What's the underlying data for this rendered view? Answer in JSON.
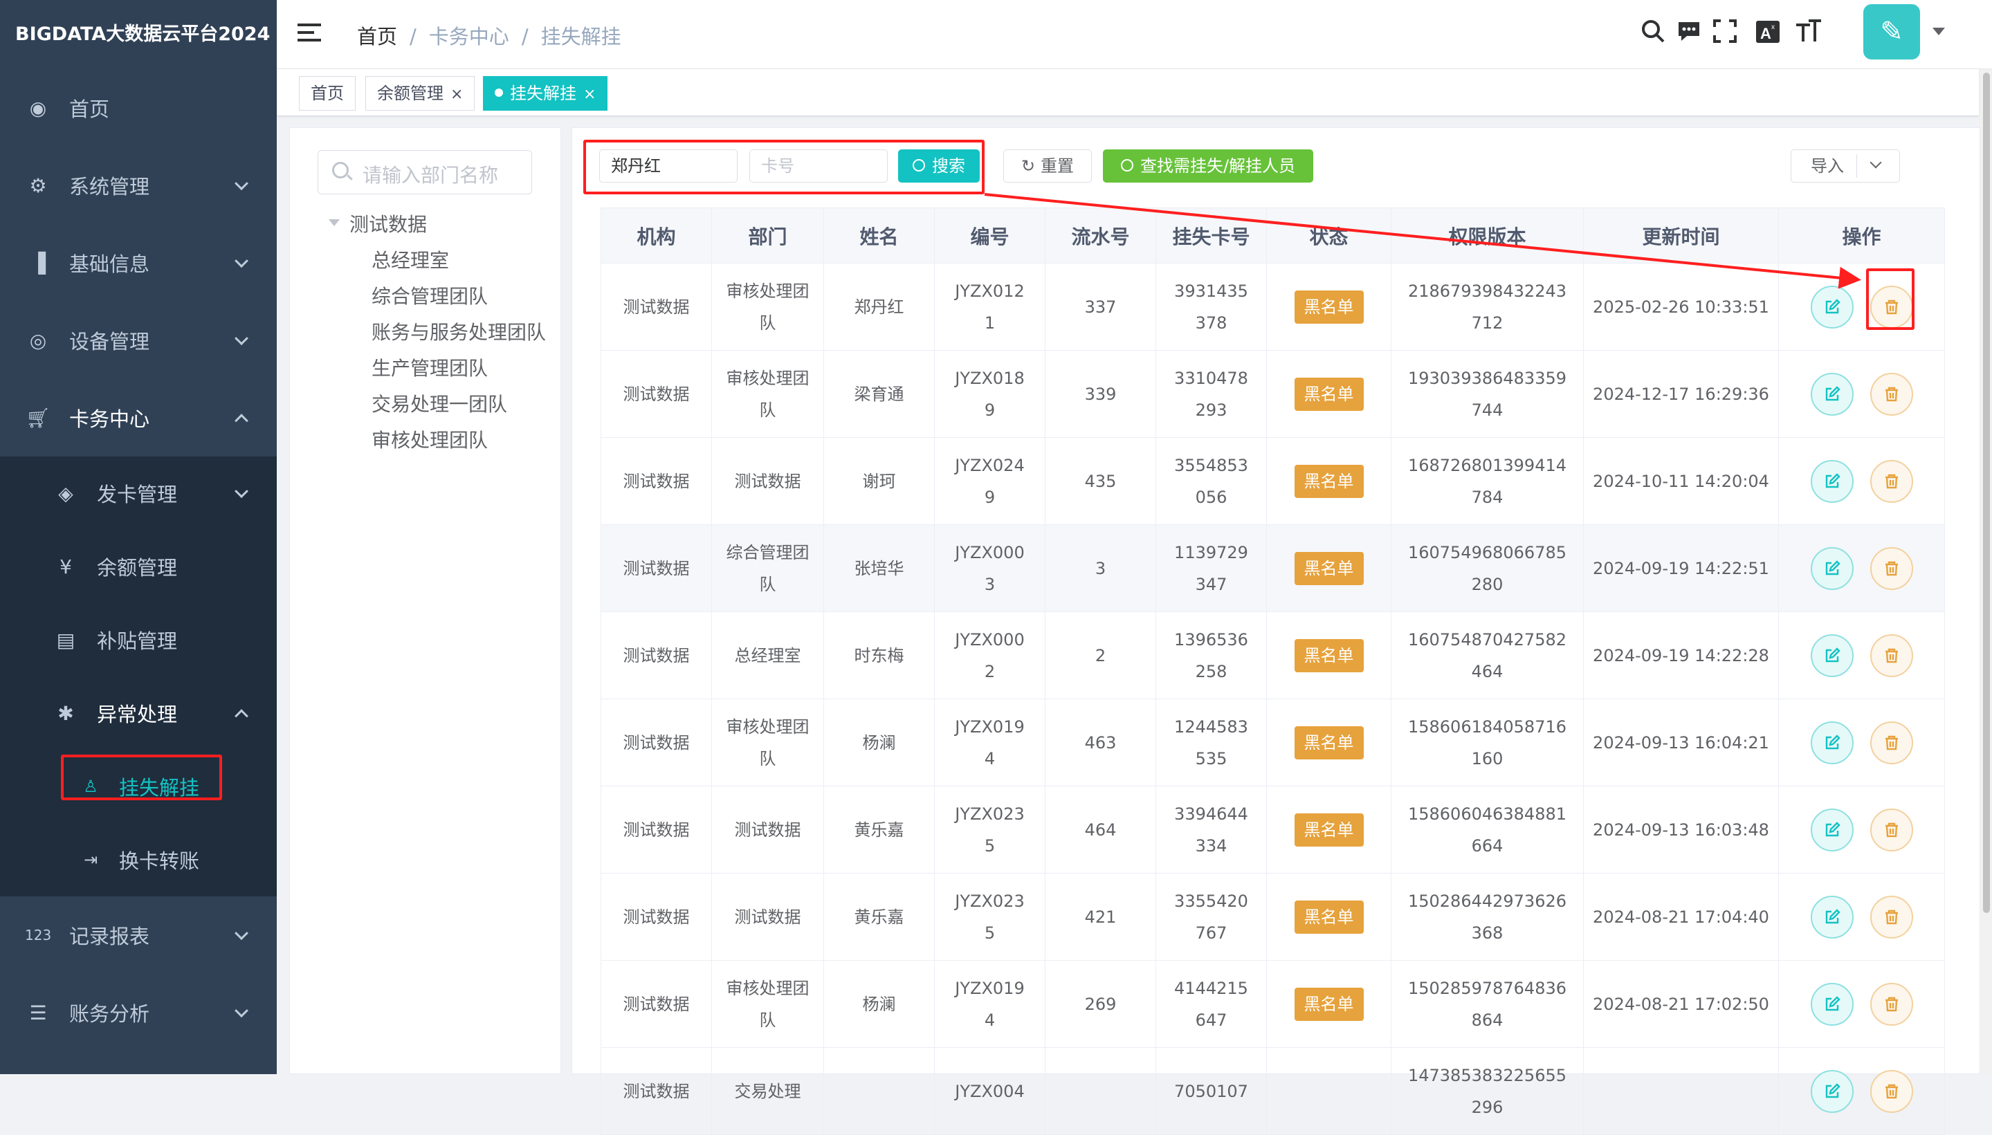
{
  "app": {
    "title": "BIGDATA大数据云平台2024"
  },
  "sidebar": {
    "items": [
      {
        "label": "首页",
        "icon": "dashboard-icon"
      },
      {
        "label": "系统管理",
        "icon": "gear-icon"
      },
      {
        "label": "基础信息",
        "icon": "bar-chart-icon"
      },
      {
        "label": "设备管理",
        "icon": "target-icon"
      },
      {
        "label": "卡务中心",
        "icon": "cart-icon"
      },
      {
        "label": "发卡管理",
        "icon": "card-icon"
      },
      {
        "label": "余额管理",
        "icon": "yen-icon"
      },
      {
        "label": "补贴管理",
        "icon": "doc-icon"
      },
      {
        "label": "异常处理",
        "icon": "bug-icon"
      },
      {
        "label": "挂失解挂",
        "icon": "user-icon"
      },
      {
        "label": "换卡转账",
        "icon": "transfer-icon"
      },
      {
        "label": "记录报表",
        "icon": "number-icon"
      },
      {
        "label": "账务分析",
        "icon": "list-icon"
      }
    ]
  },
  "breadcrumb": {
    "items": [
      "首页",
      "卡务中心",
      "挂失解挂"
    ],
    "sep": "/"
  },
  "tags": [
    {
      "label": "首页"
    },
    {
      "label": "余额管理",
      "close": "×"
    },
    {
      "label": "挂失解挂",
      "close": "×"
    }
  ],
  "dept": {
    "placeholder": "请输入部门名称",
    "root": "测试数据",
    "children": [
      "总经理室",
      "综合管理团队",
      "账务与服务处理团队",
      "生产管理团队",
      "交易处理一团队",
      "审核处理团队"
    ]
  },
  "filters": {
    "name_value": "郑丹红",
    "card_placeholder": "卡号",
    "search_label": "搜索",
    "reset_label": "重置",
    "find_label": "查找需挂失/解挂人员",
    "import_label": "导入"
  },
  "table": {
    "columns": [
      "机构",
      "部门",
      "姓名",
      "编号",
      "流水号",
      "挂失卡号",
      "状态",
      "权限版本",
      "更新时间",
      "操作"
    ],
    "rows": [
      [
        "测试数据",
        "审核处理团队",
        "郑丹红",
        "JYZX0121",
        "337",
        "3931435378",
        "黑名单",
        "218679398432243712",
        "2025-02-26 10:33:51"
      ],
      [
        "测试数据",
        "审核处理团队",
        "梁育通",
        "JYZX0189",
        "339",
        "3310478293",
        "黑名单",
        "193039386483359744",
        "2024-12-17 16:29:36"
      ],
      [
        "测试数据",
        "测试数据",
        "谢珂",
        "JYZX0249",
        "435",
        "3554853056",
        "黑名单",
        "168726801399414784",
        "2024-10-11 14:20:04"
      ],
      [
        "测试数据",
        "综合管理团队",
        "张培华",
        "JYZX0003",
        "3",
        "1139729347",
        "黑名单",
        "160754968066785280",
        "2024-09-19 14:22:51"
      ],
      [
        "测试数据",
        "总经理室",
        "时东梅",
        "JYZX0002",
        "2",
        "1396536258",
        "黑名单",
        "160754870427582464",
        "2024-09-19 14:22:28"
      ],
      [
        "测试数据",
        "审核处理团队",
        "杨澜",
        "JYZX0194",
        "463",
        "1244583535",
        "黑名单",
        "158606184058716160",
        "2024-09-13 16:04:21"
      ],
      [
        "测试数据",
        "测试数据",
        "黄乐嘉",
        "JYZX0235",
        "464",
        "3394644334",
        "黑名单",
        "158606046384881664",
        "2024-09-13 16:03:48"
      ],
      [
        "测试数据",
        "测试数据",
        "黄乐嘉",
        "JYZX0235",
        "421",
        "3355420767",
        "黑名单",
        "150286442973626368",
        "2024-08-21 17:04:40"
      ],
      [
        "测试数据",
        "审核处理团队",
        "杨澜",
        "JYZX0194",
        "269",
        "4144215647",
        "黑名单",
        "150285978764836864",
        "2024-08-21 17:02:50"
      ],
      [
        "测试数据",
        "交易处理",
        "",
        "JYZX004",
        "",
        "7050107",
        "",
        "147385383225655296",
        ""
      ]
    ]
  },
  "colors": {
    "sidebar_bg": "#304156",
    "accent": "#13c2c2",
    "warning": "#e6a23c",
    "success": "#67c23a",
    "highlight": "#ff1f1f"
  }
}
